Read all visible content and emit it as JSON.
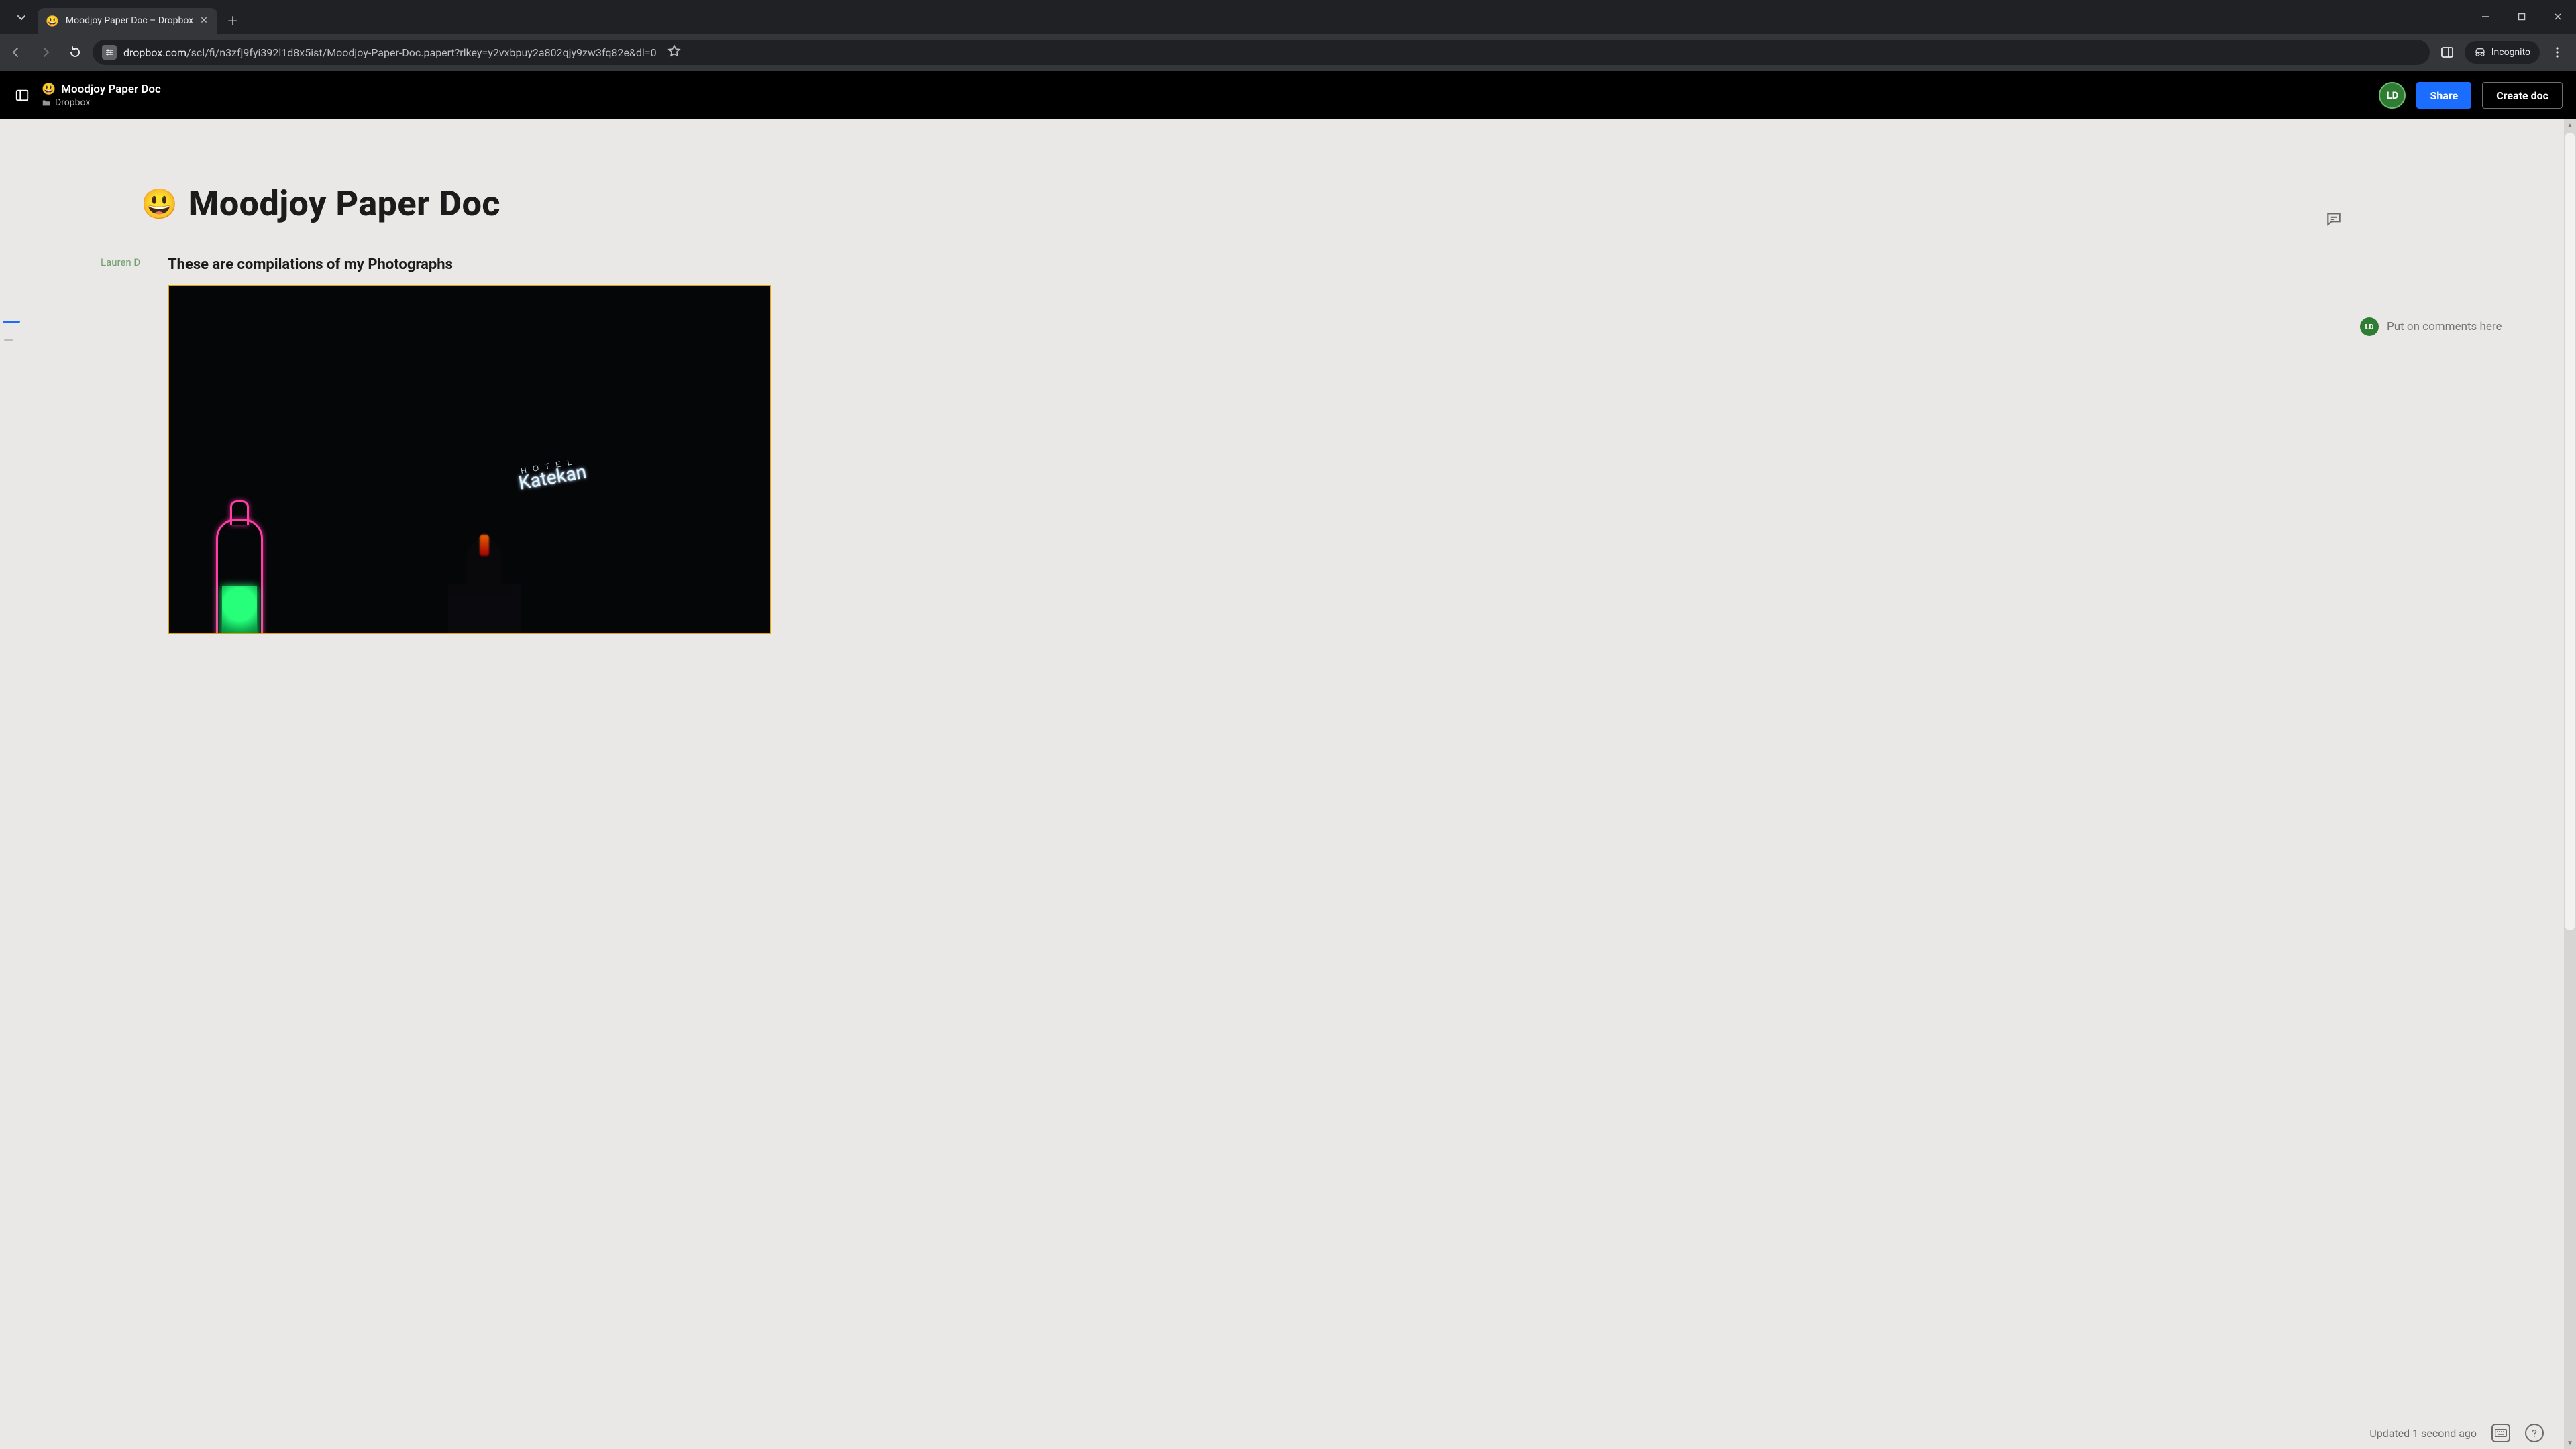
{
  "browser": {
    "tab": {
      "favicon": "😃",
      "title": "Moodjoy Paper Doc – Dropbox"
    },
    "url_host": "dropbox.com",
    "url_path": "/scl/fi/n3zfj9fyi392l1d8x5ist/Moodjoy-Paper-Doc.papert?rlkey=y2vxbpuy2a802qjy9zw3fq82e&dl=0",
    "incognito_label": "Incognito"
  },
  "header": {
    "doc_emoji": "😃",
    "doc_title": "Moodjoy Paper Doc",
    "breadcrumb_root": "Dropbox",
    "avatar_initials": "LD",
    "share_label": "Share",
    "create_label": "Create doc"
  },
  "document": {
    "title_emoji": "😃",
    "title": "Moodjoy Paper Doc",
    "attribution": "Lauren D",
    "body_heading": "These are compilations of my Photographs",
    "photo": {
      "hotel_small": "H O T E L",
      "hotel_script": "Katekan"
    }
  },
  "comments": {
    "avatar_initials": "LD",
    "placeholder": "Put on comments here"
  },
  "footer": {
    "status": "Updated 1 second ago"
  }
}
